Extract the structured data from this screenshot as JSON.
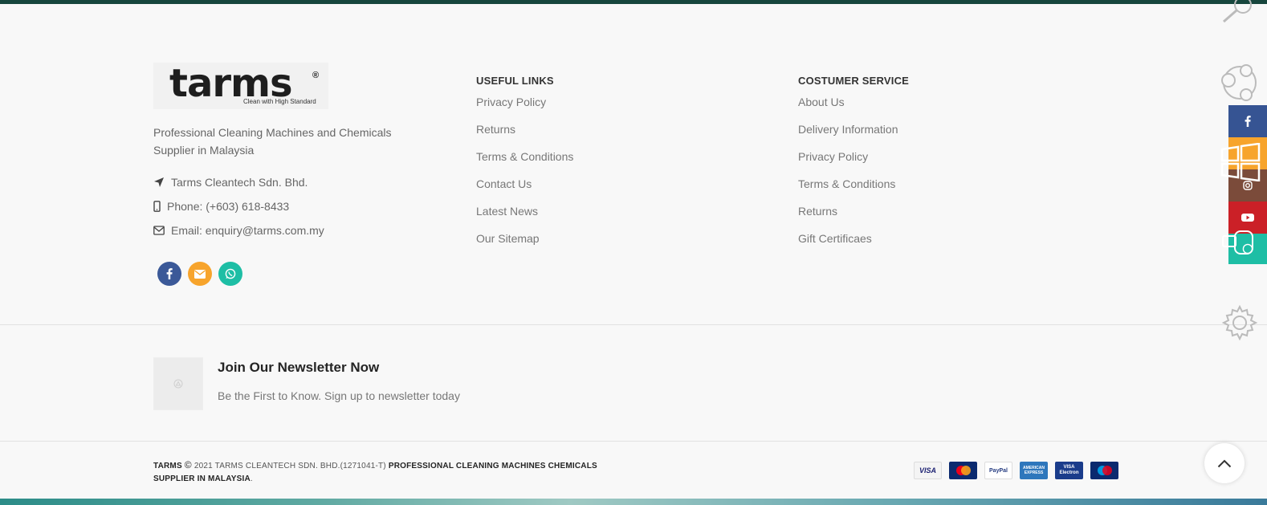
{
  "brand": {
    "logo_word": "tarms",
    "logo_reg": "®",
    "logo_tagline": "Clean with High Standard",
    "description": "Professional Cleaning Machines and Chemicals Supplier in Malaysia"
  },
  "contact": {
    "company": "Tarms Cleantech Sdn. Bhd.",
    "phone": "Phone: (+603) 618-8433",
    "email": "Email: enquiry@tarms.com.my"
  },
  "socials": [
    {
      "name": "facebook",
      "color": "#3b5998"
    },
    {
      "name": "email",
      "color": "#f7a42c"
    },
    {
      "name": "whatsapp",
      "color": "#1ebea5"
    }
  ],
  "useful_links": {
    "title": "USEFUL LINKS",
    "items": [
      "Privacy Policy",
      "Returns",
      "Terms & Conditions",
      "Contact Us",
      "Latest News",
      "Our Sitemap"
    ]
  },
  "customer_service": {
    "title": "COSTUMER SERVICE",
    "items": [
      "About Us",
      "Delivery Information",
      "Privacy Policy",
      "Terms & Conditions",
      "Returns",
      "Gift Certificaes"
    ]
  },
  "newsletter": {
    "title": "Join Our Newsletter Now",
    "subtitle": "Be the First to Know. Sign up to newsletter today"
  },
  "copyright": {
    "brand": "TARMS",
    "symbol": "©",
    "text": " 2021 TARMS CLEANTECH SDN. BHD.(1271041-T) ",
    "tagline": "PROFESSIONAL CLEANING MACHINES CHEMICALS SUPPLIER IN MALAYSIA",
    "end": "."
  },
  "payments": [
    {
      "name": "visa",
      "label": "VISA",
      "bg": "#f4f4f4",
      "fg": "#1a1f71"
    },
    {
      "name": "mastercard",
      "label": "MasterCard",
      "bg": "#0b2a6f",
      "fg": "#ffffff"
    },
    {
      "name": "paypal",
      "label": "PayPal",
      "bg": "#ffffff",
      "fg": "#253b80"
    },
    {
      "name": "american-express",
      "label": "AMERICAN EXPRESS",
      "bg": "#2e77bc",
      "fg": "#ffffff"
    },
    {
      "name": "visa-electron",
      "label": "VISA Electron",
      "bg": "#1a3c8b",
      "fg": "#ffffff"
    },
    {
      "name": "maestro",
      "label": "Maestro",
      "bg": "#0b2a6f",
      "fg": "#ffffff"
    }
  ],
  "side_bar": {
    "colors": {
      "facebook": "#365493",
      "instagram": "#7b4b3a",
      "youtube": "#cb2027",
      "whatsapp": "#1ebea5",
      "accent": "#f7a42c"
    }
  }
}
